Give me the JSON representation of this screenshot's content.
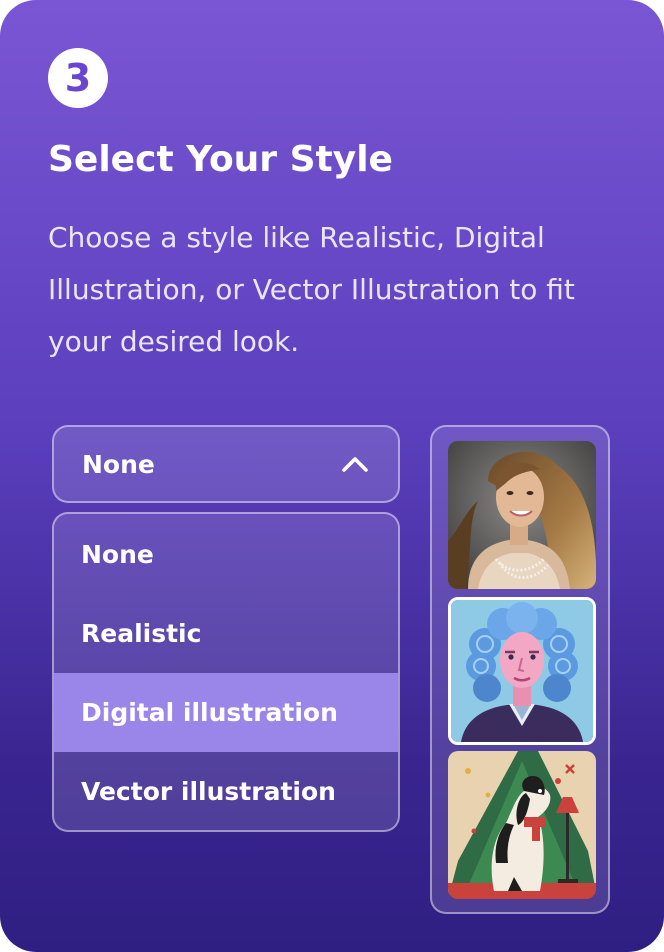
{
  "step": {
    "number": "3"
  },
  "header": {
    "title": "Select Your Style",
    "description": "Choose a style like Realistic, Digital Illustration, or Vector Illustration to fit your desired look."
  },
  "style_select": {
    "selected_value": "None",
    "state": "expanded",
    "chevron_icon": "chevron-up-icon",
    "options": [
      {
        "label": "None"
      },
      {
        "label": "Realistic"
      },
      {
        "label": "Digital illustration",
        "highlighted": true
      },
      {
        "label": "Vector illustration"
      }
    ]
  },
  "previews": [
    {
      "style": "realistic",
      "icon": "realistic-portrait-image"
    },
    {
      "style": "digital-illustration",
      "icon": "digital-illustration-portrait-image",
      "selected": true
    },
    {
      "style": "vector-illustration",
      "icon": "vector-illustration-dog-image"
    }
  ],
  "colors": {
    "background_top": "#7a56d4",
    "background_bottom": "#2f1f82",
    "badge_text": "#6a46d0",
    "highlight": "#9a86e8",
    "text": "#ffffff"
  }
}
